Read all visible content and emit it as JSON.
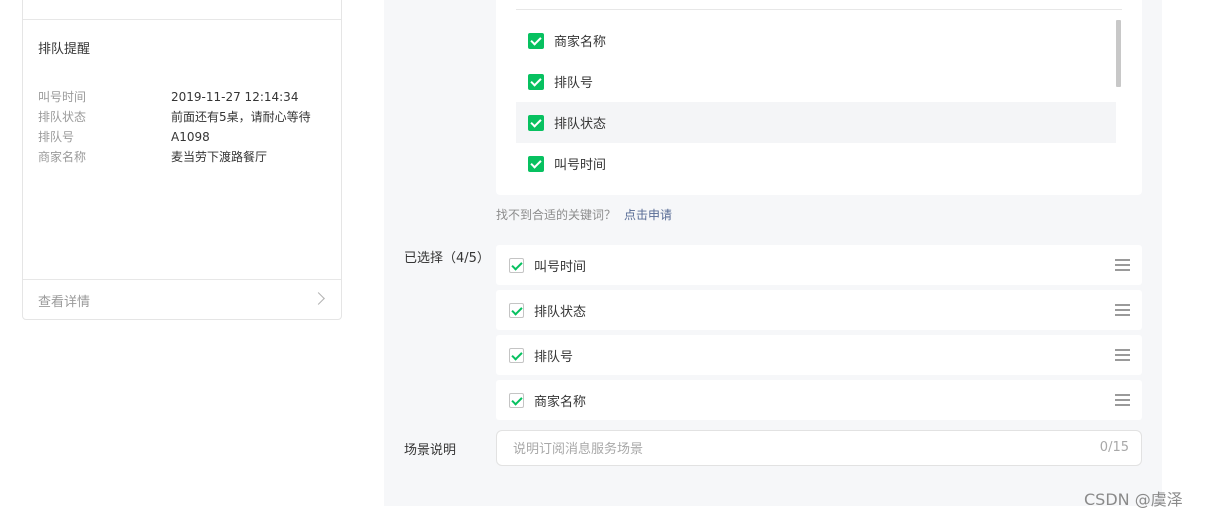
{
  "preview": {
    "title": "排队提醒",
    "rows": [
      {
        "key": "叫号时间",
        "value": "2019-11-27 12:14:34"
      },
      {
        "key": "排队状态",
        "value": "前面还有5桌，请耐心等待"
      },
      {
        "key": "排队号",
        "value": "A1098"
      },
      {
        "key": "商家名称",
        "value": "麦当劳下渡路餐厅"
      }
    ],
    "details_label": "查看详情"
  },
  "keyword_options": [
    {
      "label": "商家名称",
      "checked": true
    },
    {
      "label": "排队号",
      "checked": true
    },
    {
      "label": "排队状态",
      "checked": true
    },
    {
      "label": "叫号时间",
      "checked": true
    }
  ],
  "hint": {
    "text": "找不到合适的关键词？",
    "link": "点击申请"
  },
  "selected": {
    "label": "已选择（4/5）",
    "items": [
      "叫号时间",
      "排队状态",
      "排队号",
      "商家名称"
    ]
  },
  "scene": {
    "label": "场景说明",
    "placeholder": "说明订阅消息服务场景",
    "counter": "0/15"
  },
  "watermark": "CSDN @虞泽",
  "colors": {
    "accent_green": "#07c160",
    "link_blue": "#576b95"
  }
}
